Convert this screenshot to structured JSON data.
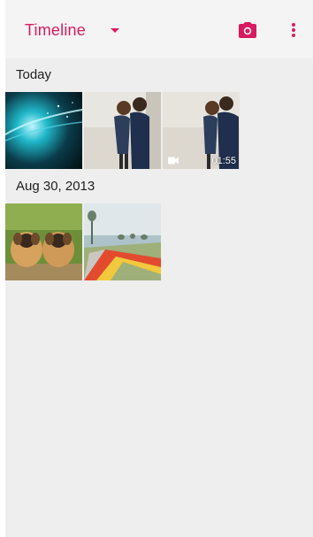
{
  "toolbar": {
    "title": "Timeline",
    "dropdown_icon": "arrow-drop-down-icon",
    "camera_icon": "camera-icon",
    "more_icon": "more-vert-icon"
  },
  "colors": {
    "accent": "#d81b60",
    "background": "#eeeeee",
    "toolbar": "#f4f4f4"
  },
  "sections": [
    {
      "label": "Today",
      "items": [
        {
          "type": "photo",
          "subject": "abstract blue light"
        },
        {
          "type": "photo",
          "subject": "couple"
        },
        {
          "type": "video",
          "subject": "couple",
          "duration": "01:55"
        }
      ]
    },
    {
      "label": "Aug 30, 2013",
      "items": [
        {
          "type": "photo",
          "subject": "puppies"
        },
        {
          "type": "photo",
          "subject": "lakeside path"
        }
      ]
    }
  ]
}
